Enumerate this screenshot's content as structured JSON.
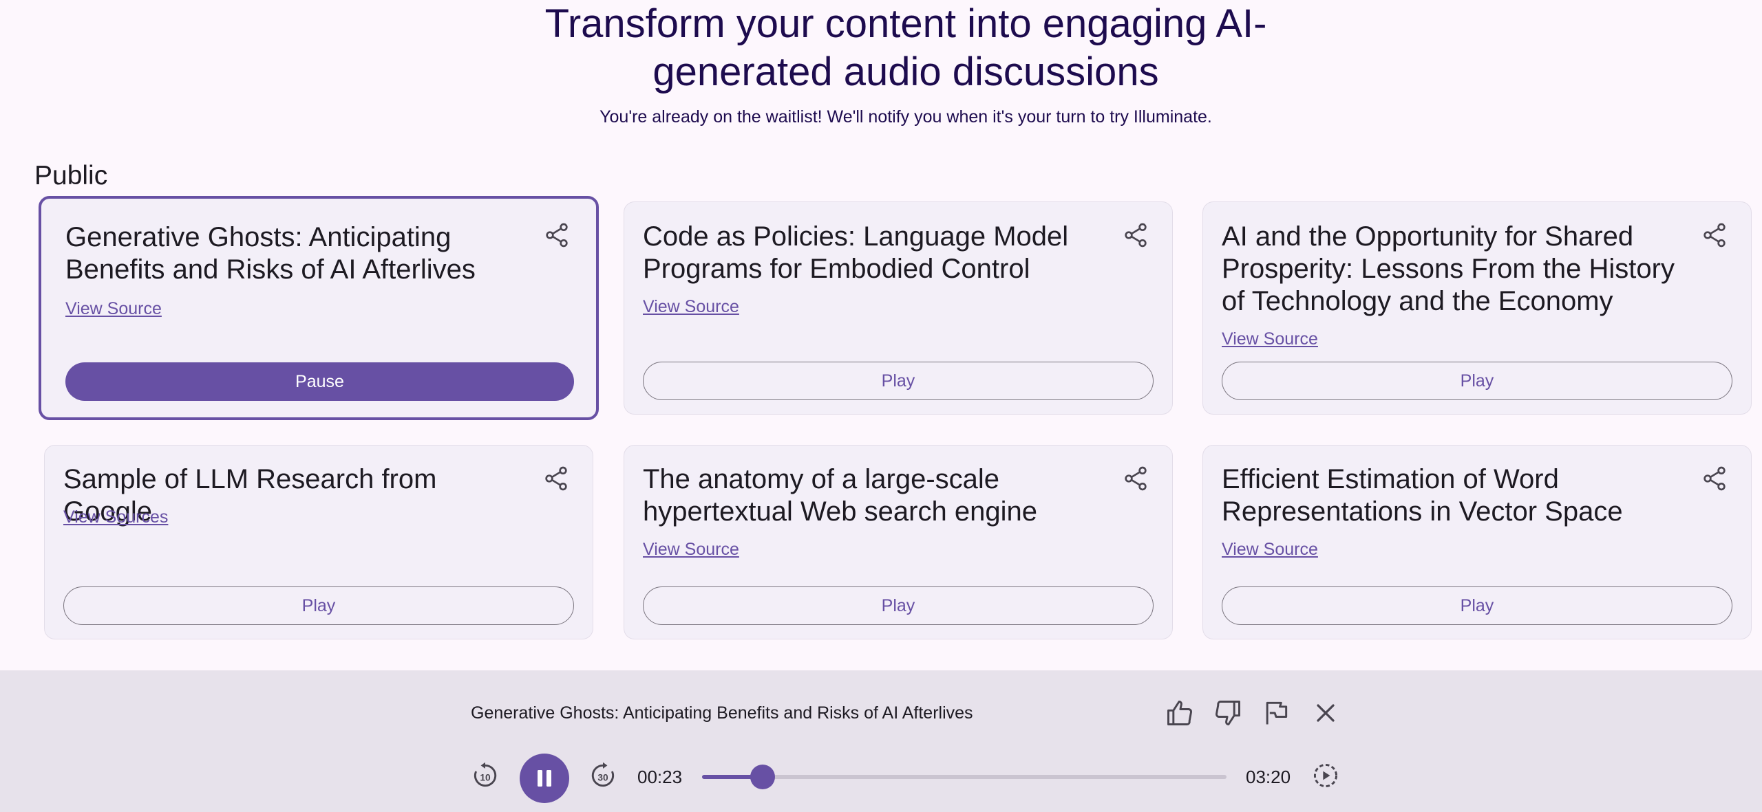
{
  "hero": {
    "title_line1": "Transform your content into engaging AI-",
    "title_line2": "generated audio discussions",
    "subtitle": "You're already on the waitlist! We'll notify you when it's your turn to try Illuminate."
  },
  "section": {
    "title": "Public"
  },
  "cards": [
    {
      "title": "Generative Ghosts: Anticipating Benefits and Risks of AI Afterlives",
      "link": "View Source",
      "button": "Pause",
      "active": true
    },
    {
      "title": "Code as Policies: Language Model Programs for Embodied Control",
      "link": "View Source",
      "button": "Play"
    },
    {
      "title": "AI and the Opportunity for Shared Prosperity: Lessons From the History of Technology and the Economy",
      "link": "View Source",
      "button": "Play"
    },
    {
      "title": "Sample of LLM Research from Google",
      "link": "View Sources",
      "button": "Play"
    },
    {
      "title": "The anatomy of a large-scale hypertextual Web search engine",
      "link": "View Source",
      "button": "Play"
    },
    {
      "title": "Efficient Estimation of Word Representations in Vector Space",
      "link": "View Source",
      "button": "Play"
    }
  ],
  "player": {
    "title": "Generative Ghosts: Anticipating Benefits and Risks of AI Afterlives",
    "elapsed": "00:23",
    "duration": "03:20",
    "progress_fraction": 0.115,
    "icons": [
      "thumb-up-icon",
      "thumb-down-icon",
      "flag-icon",
      "close-icon",
      "rewind-10-icon",
      "pause-icon",
      "forward-30-icon",
      "playback-speed-icon"
    ]
  },
  "colors": {
    "accent": "#6750a4",
    "title": "#1d0b4e",
    "card_bg": "#f3eff8",
    "player_bg": "#e7e2eb",
    "page_bg": "#fdf7fd"
  }
}
